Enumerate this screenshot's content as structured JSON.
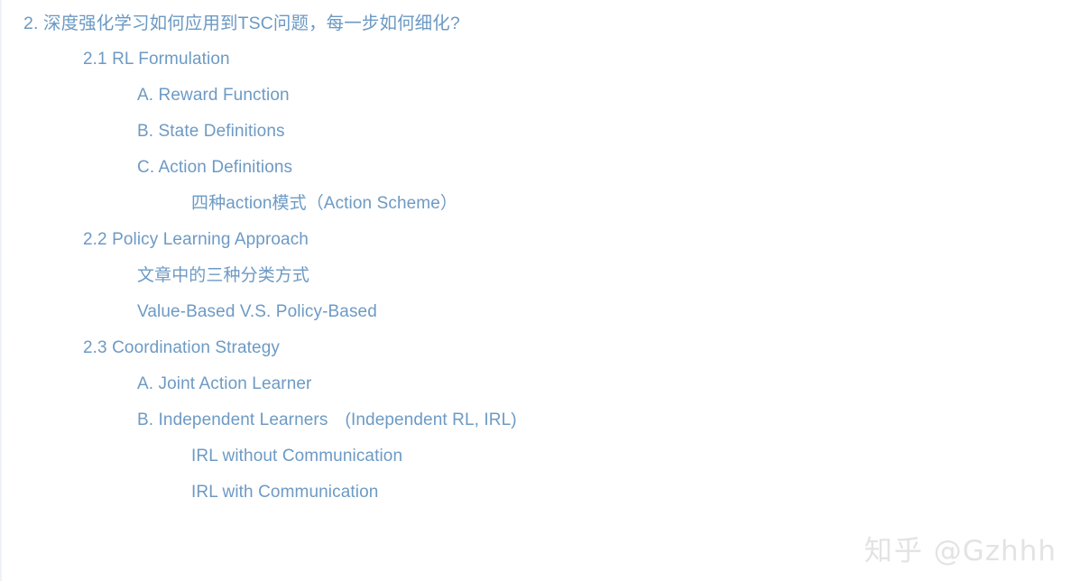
{
  "document": {
    "title": "2. 深度强化学习如何应用到TSC问题，每一步如何细化?",
    "text_color": "#6d9ac4",
    "background_color": "#ffffff",
    "outline": [
      {
        "level": 0,
        "text": "2. 深度强化学习如何应用到TSC问题，每一步如何细化?"
      },
      {
        "level": 1,
        "text": "2.1 RL Formulation"
      },
      {
        "level": 2,
        "text": "A. Reward Function"
      },
      {
        "level": 2,
        "text": "B. State Definitions"
      },
      {
        "level": 2,
        "text": "C. Action Definitions"
      },
      {
        "level": 3,
        "text": "四种action模式（Action Scheme）"
      },
      {
        "level": 1,
        "text": "2.2 Policy Learning Approach"
      },
      {
        "level": 2,
        "text": "文章中的三种分类方式"
      },
      {
        "level": 2,
        "text": "Value-Based V.S. Policy-Based"
      },
      {
        "level": 1,
        "text": "2.3 Coordination Strategy"
      },
      {
        "level": 2,
        "text": "A. Joint Action Learner"
      },
      {
        "level": 2,
        "text": "B. Independent Learners　(Independent RL, IRL)"
      },
      {
        "level": 3,
        "text": "IRL without Communication"
      },
      {
        "level": 3,
        "text": "IRL with Communication"
      }
    ]
  },
  "watermark": {
    "site": "知乎",
    "handle": "@Gzhhh",
    "color": "#e3e3e3"
  }
}
